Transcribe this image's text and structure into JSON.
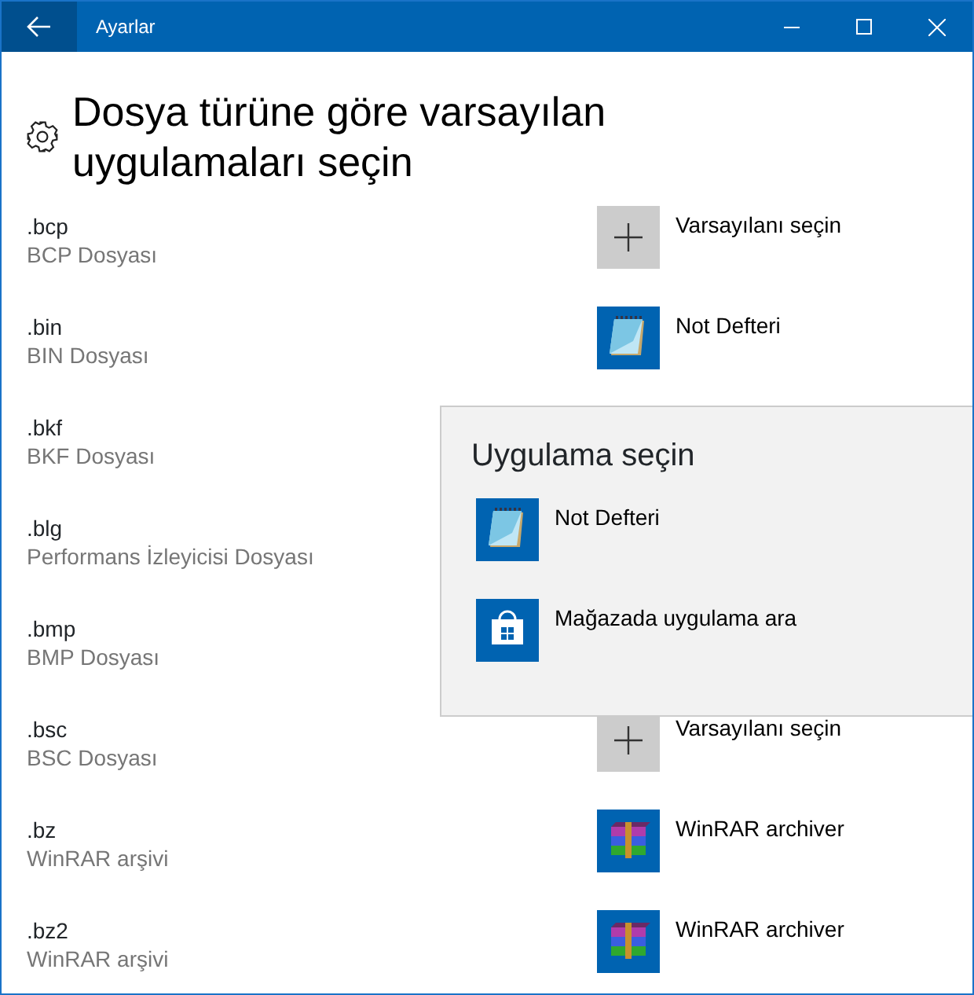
{
  "window": {
    "title": "Ayarlar"
  },
  "page": {
    "title": "Dosya türüne göre varsayılan uygulamaları seçin"
  },
  "file_types": [
    {
      "extension": ".bcp",
      "description": "BCP Dosyası",
      "app": {
        "kind": "add",
        "label": "Varsayılanı seçin"
      }
    },
    {
      "extension": ".bin",
      "description": "BIN Dosyası",
      "app": {
        "kind": "notepad",
        "label": "Not Defteri"
      }
    },
    {
      "extension": ".bkf",
      "description": "BKF Dosyası"
    },
    {
      "extension": ".blg",
      "description": "Performans İzleyicisi Dosyası"
    },
    {
      "extension": ".bmp",
      "description": "BMP Dosyası"
    },
    {
      "extension": ".bsc",
      "description": "BSC Dosyası",
      "app": {
        "kind": "add",
        "label": "Varsayılanı seçin"
      }
    },
    {
      "extension": ".bz",
      "description": "WinRAR arşivi",
      "app": {
        "kind": "winrar",
        "label": "WinRAR archiver"
      }
    },
    {
      "extension": ".bz2",
      "description": "WinRAR arşivi",
      "app": {
        "kind": "winrar",
        "label": "WinRAR archiver"
      }
    }
  ],
  "app_picker": {
    "title": "Uygulama seçin",
    "items": [
      {
        "kind": "notepad",
        "label": "Not Defteri"
      },
      {
        "kind": "store",
        "label": "Mağazada uygulama ara"
      }
    ]
  }
}
